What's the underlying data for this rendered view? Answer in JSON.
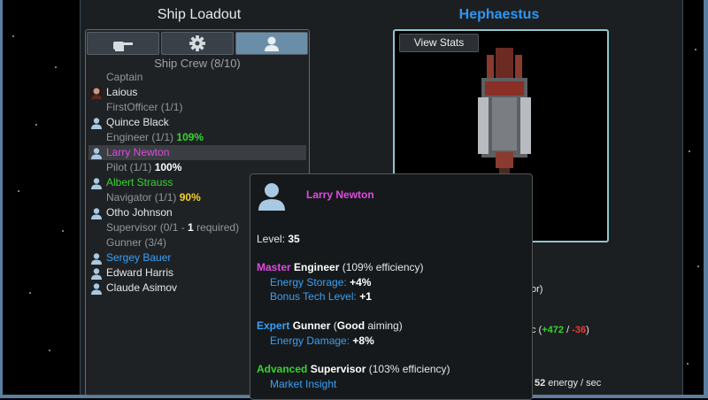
{
  "left_title": "Ship Loadout",
  "ship_name": "Hephaestus",
  "tabs": [
    {
      "icon": "turret-icon",
      "active": false
    },
    {
      "icon": "gear-icon",
      "active": false
    },
    {
      "icon": "person-icon",
      "active": true
    }
  ],
  "crew_header": "Ship Crew (8/10)",
  "crew_list": {
    "captain_role": "Captain",
    "laious": "Laious",
    "firstofficer_role": "FirstOfficer (1/1)",
    "quince": "Quince Black",
    "engineer_role": "Engineer (1/1)",
    "engineer_pct": "109%",
    "larry": "Larry Newton",
    "pilot_role": "Pilot (1/1)",
    "pilot_pct": "100%",
    "albert": "Albert Strauss",
    "navigator_role": "Navigator (1/1)",
    "navigator_pct": "90%",
    "otho": "Otho Johnson",
    "supervisor_role_a": "Supervisor (0/1 - ",
    "supervisor_role_b": "1",
    "supervisor_role_c": " required)",
    "gunner_role": "Gunner (3/4)",
    "sergey": "Sergey Bauer",
    "edward": "Edward Harris",
    "claude": "Claude Asimov"
  },
  "view_stats_label": "View Stats",
  "peek": {
    "a": "or)",
    "b_prefix": "c (",
    "b_pos": "+472",
    "b_sep": " / ",
    "b_neg": "-36",
    "b_suffix": ")",
    "c_val": "52",
    "c_unit": " energy / sec"
  },
  "tooltip": {
    "name": "Larry Newton",
    "level_label": "Level: ",
    "level_value": "35",
    "skills": [
      {
        "rank": "Master",
        "title": " Engineer",
        "desc": " (109% efficiency)",
        "bonuses": [
          {
            "label": "Energy Storage: ",
            "value": "+4%"
          },
          {
            "label": "Bonus Tech Level: ",
            "value": "+1"
          }
        ]
      },
      {
        "rank": "Expert",
        "title": " Gunner",
        "desc_a": " (",
        "desc_b": "Good",
        "desc_c": " aiming)",
        "bonuses": [
          {
            "label": "Energy Damage: ",
            "value": "+8%"
          }
        ]
      },
      {
        "rank": "Advanced",
        "title": " Supervisor",
        "desc": " (103% efficiency)",
        "bonuses": [
          {
            "label": "Market Insight"
          }
        ]
      }
    ]
  }
}
